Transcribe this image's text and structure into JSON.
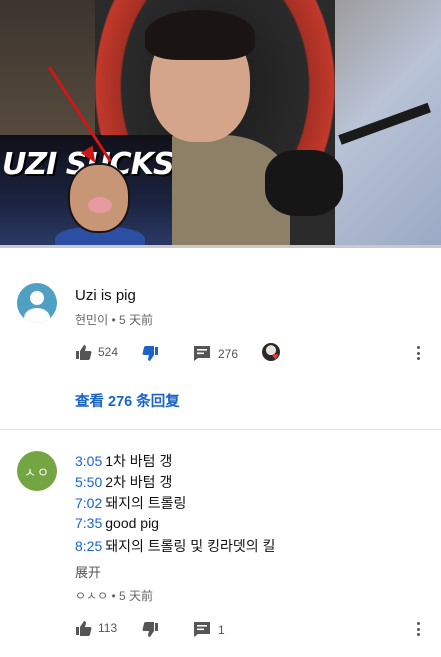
{
  "video": {
    "thumbnail_text": "UZI SUCKS",
    "progress_fraction": 0.0
  },
  "comments": [
    {
      "author_avatar_icon": "default-person-avatar",
      "text": "Uzi is pig",
      "author": "현민이",
      "time": "5 天前",
      "likes": "524",
      "replies_count": "276",
      "view_replies_label": "查看 276 条回复",
      "creator_heart": true
    },
    {
      "author_avatar_text": "ㅅㅇ",
      "lines": [
        {
          "timestamp": "3:05",
          "text": "1차 바텀 갱"
        },
        {
          "timestamp": "5:50",
          "text": "2차 바텀 갱"
        },
        {
          "timestamp": "7:02",
          "text": "돼지의 트롤링"
        },
        {
          "timestamp": "7:35",
          "text": "good pig"
        },
        {
          "timestamp": "8:25",
          "text": "돼지의 트롤링 및 킹라뎃의 킬"
        }
      ],
      "expand_label": "展开",
      "author": "ㅇㅅㅇ",
      "time": "5 天前",
      "likes": "113",
      "replies_count": "1"
    }
  ],
  "colors": {
    "link_blue": "#1a64c8",
    "avatar_blue": "#4fa0c2",
    "avatar_green": "#74a543"
  }
}
